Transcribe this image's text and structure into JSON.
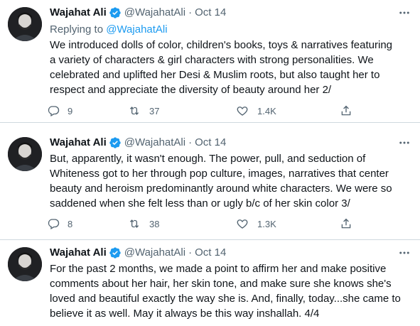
{
  "tweets": [
    {
      "name": "Wajahat Ali",
      "handle": "@WajahatAli",
      "separator": "·",
      "time": "Oct 14",
      "replying_to": "Replying to",
      "replying_mention": "@WajahatAli",
      "lines": [
        "We introduced dolls of color, children's books, toys & narratives featuring",
        "a variety of characters & girl characters with strong personalities. We",
        "celebrated and uplifted her Desi & Muslim roots, but also taught her to",
        "respect and appreciate the diversity of beauty around her 2/"
      ],
      "replies": "9",
      "retweets": "37",
      "likes": "1.4K"
    },
    {
      "name": "Wajahat Ali",
      "handle": "@WajahatAli",
      "separator": "·",
      "time": "Oct 14",
      "lines": [
        "But, apparently, it wasn't enough. The power, pull, and seduction of",
        "Whiteness got to her through pop culture, images, narratives that center",
        "beauty and heroism predominantly around white characters. We were so",
        "saddened when she felt less than or ugly b/c of her skin color 3/"
      ],
      "replies": "8",
      "retweets": "38",
      "likes": "1.3K"
    },
    {
      "name": "Wajahat Ali",
      "handle": "@WajahatAli",
      "separator": "·",
      "time": "Oct 14",
      "lines": [
        "For the past 2 months, we made a point to affirm her and make positive",
        "comments about her hair, her skin tone, and make sure she knows she's",
        "loved and beautiful exactly the way she is. And, finally, today...she came to",
        "believe it as well. May it always be this way inshallah. 4/4"
      ]
    }
  ],
  "colors": {
    "text": "#0f1419",
    "secondary": "#536471",
    "link": "#1d9bf0",
    "verified": "#1d9bf0",
    "divider": "#cfd9de"
  },
  "icons": {
    "more": "more-dots-icon",
    "verified": "verified-badge-icon",
    "reply": "reply-bubble-icon",
    "retweet": "retweet-icon",
    "like": "heart-icon",
    "share": "share-icon"
  }
}
